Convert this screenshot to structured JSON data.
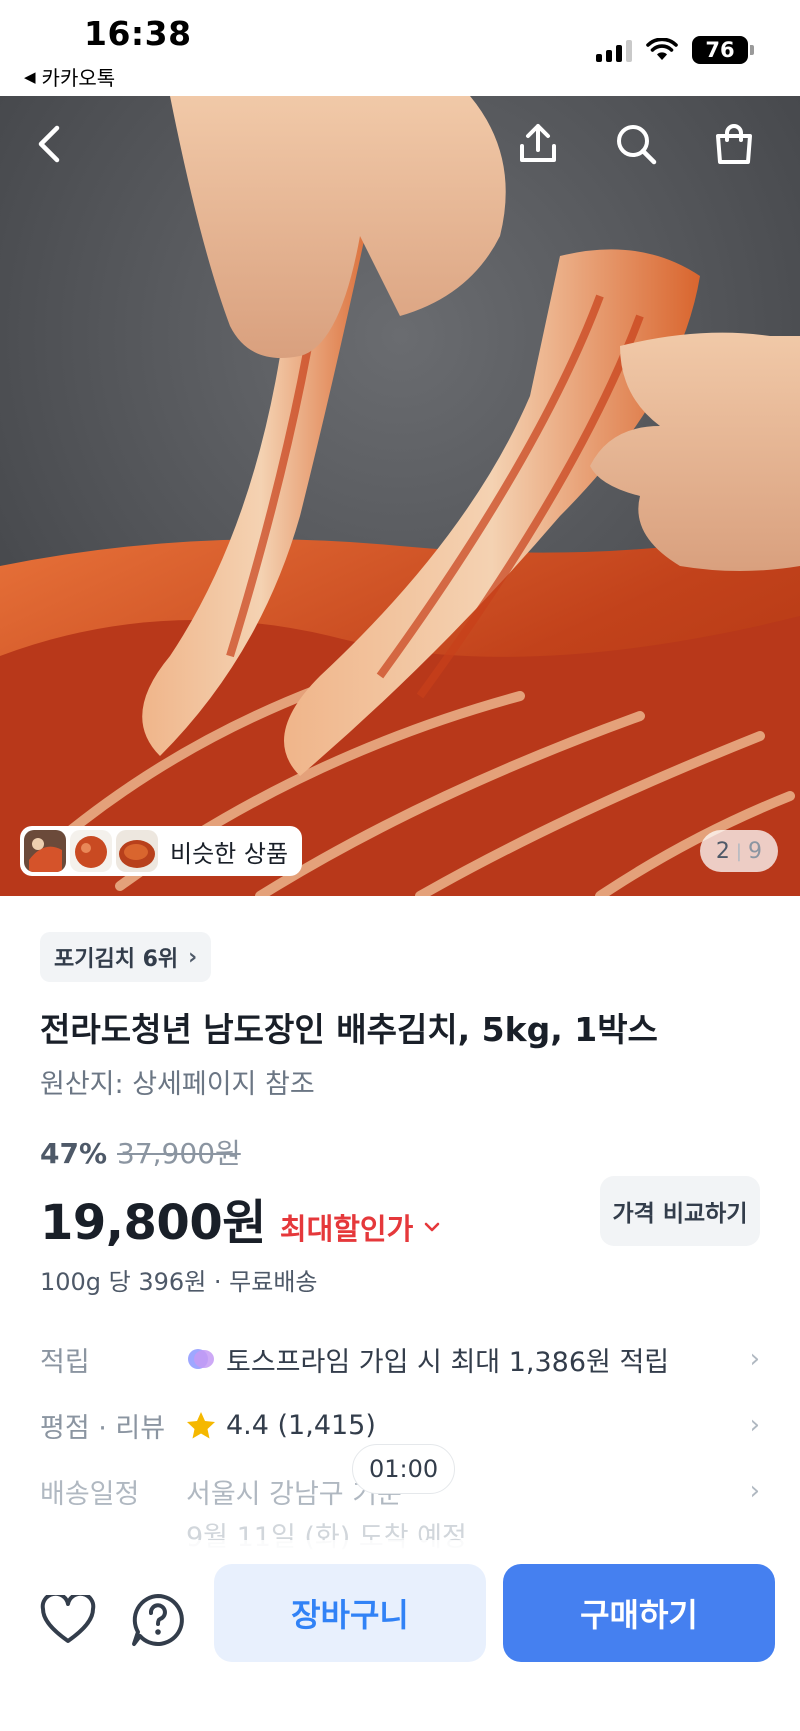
{
  "status_bar": {
    "time": "16:38",
    "back_app": "카카오톡",
    "battery": "76"
  },
  "hero": {
    "image_icon": "kimchi-photo",
    "similar_label": "비슷한 상품",
    "page_current": "2",
    "page_total": "9"
  },
  "product": {
    "rank_chip": "포기김치 6위",
    "title": "전라도청년 남도장인 배추김치, 5kg, 1박스",
    "origin": "원산지: 상세페이지 참조",
    "discount": "47%",
    "original_price": "37,900원",
    "price": "19,800원",
    "max_discount_label": "최대할인가",
    "compare_button": "가격 비교하기",
    "unit_price": "100g 당 396원 · 무료배송"
  },
  "info": {
    "points_label": "적립",
    "points_value": "토스프라임 가입 시 최대 1,386원 적립",
    "rating_label": "평점 · 리뷰",
    "rating_value": "4.4 (1,415)",
    "delivery_label": "배송일정",
    "delivery_value": "서울시 강남구 기준",
    "delivery_date": "9월 11일 (화) 도착 예정",
    "time_bubble": "01:00"
  },
  "bottom": {
    "cart_label": "장바구니",
    "buy_label": "구매하기"
  },
  "colors": {
    "accent_blue": "#4580f0",
    "discount_red": "#e5383b",
    "star_yellow": "#f5b800"
  }
}
